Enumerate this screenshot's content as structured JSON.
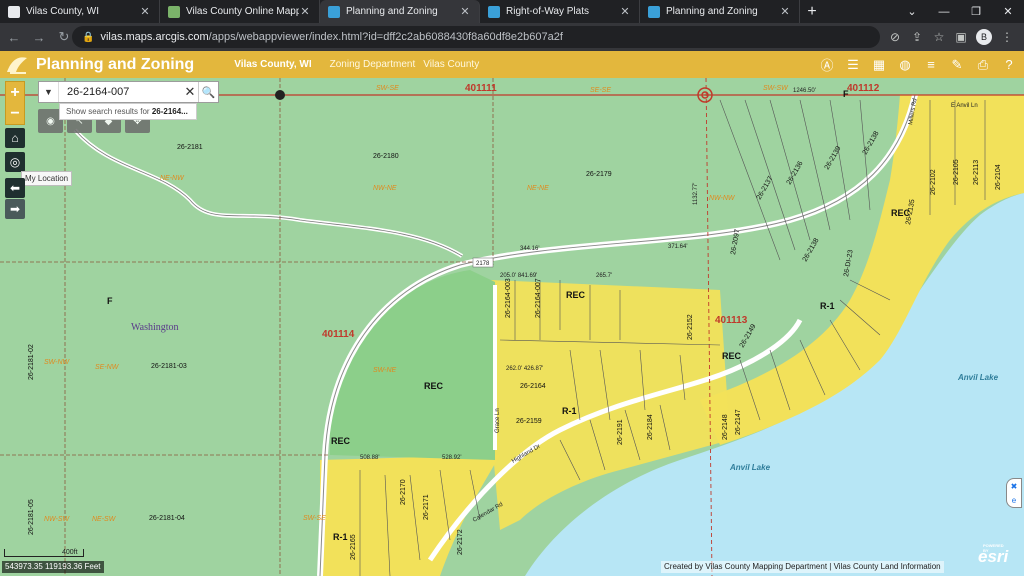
{
  "browser": {
    "tabs": [
      {
        "title": "Vilas County, WI",
        "active": false
      },
      {
        "title": "Vilas County Online Mapping",
        "active": false
      },
      {
        "title": "Planning and Zoning",
        "active": true
      },
      {
        "title": "Right-of-Way Plats",
        "active": false
      },
      {
        "title": "Planning and Zoning",
        "active": false
      }
    ],
    "new_tab": "+",
    "url_host": "vilas.maps.arcgis.com",
    "url_path": "/apps/webappviewer/index.html?id=dff2c2ab6088430f8a60df8e2b607a2f",
    "profile_initial": "B"
  },
  "app": {
    "title": "Planning and Zoning",
    "subtitle": "Vilas County, WI",
    "links": [
      "Zoning Department",
      "Vilas County"
    ],
    "tool_icons": [
      "north-arrow-icon",
      "layer-list-icon",
      "basemap-gallery-icon",
      "measure-icon",
      "legend-icon",
      "draw-icon",
      "print-icon",
      "help-icon"
    ]
  },
  "map": {
    "search_value": "26-2164-007",
    "search_suggestion_prefix": "Show search results for ",
    "search_suggestion_term": "26-2164...",
    "tooltip": "My Location",
    "scale_label": "400ft",
    "coordinates": "543973.35 119193.36 Feet",
    "attribution": "Created by Vilas County Mapping Department | Vilas County Land Information",
    "esri_powered": "POWERED BY",
    "esri_label": "esri",
    "colors": {
      "parcel": "#9fd3a0",
      "shoreland": "#f2e15a",
      "lake": "#b7e6f5",
      "section_line": "#c0392b"
    },
    "labels": {
      "sec_401111": "401111",
      "sec_401112": "401112",
      "sec_401113": "401113",
      "sec_401114": "401114",
      "township": "Washington",
      "f1": "F",
      "f2": "F",
      "rec1": "REC",
      "rec2": "REC",
      "rec3": "REC",
      "rec4": "REC",
      "rec5": "REC",
      "r1a": "R-1",
      "r1b": "R-1",
      "r1c": "R-1",
      "anvil_lake_1": "Anvil Lake",
      "anvil_lake_2": "Anvil Lake",
      "q_sw_se": "SW-SE",
      "q_se_se": "SE-SE",
      "q_sw_sw": "SW-SW",
      "q_ne_nw": "NE-NW",
      "q_nw_ne": "NW-NE",
      "q_ne_ne": "NE-NE",
      "q_nw_nw": "NW-NW",
      "q_sw_ne": "SW-NE",
      "q_se_nw": "SE-NW",
      "q_sw_nw": "SW-NW",
      "q_nw_sw": "NW-SW",
      "q_ne_sw": "NE-SW",
      "q_sw_sw2": "SW-SE",
      "p2181": "26-2181",
      "p2180": "26-2180",
      "p2179": "26-2179",
      "p2181_03": "26-2181-03",
      "p2181_02": "26-2181-02",
      "p2181_04": "26-2181-04",
      "p2181_05": "26-2181-05",
      "p2164": "26-2164",
      "p2164_003": "26-2164-003",
      "p2164_007": "26-2164-007",
      "p2159": "26-2159",
      "p2191": "26-2191",
      "p2184": "26-2184",
      "p2152": "26-2152",
      "p2149": "26-2149",
      "p2148": "26-2148",
      "p2147": "26-2147",
      "p2170": "26-2170",
      "p2171": "26-2171",
      "p2172": "26-2172",
      "p2165": "26-2165",
      "p2105": "26-2105",
      "p2102": "26-2102",
      "p2104": "26-2104",
      "p2113": "26-2113",
      "p2138": "26-2138",
      "p2139": "26-2139",
      "p2136": "26-2136",
      "p2137": "26-2137",
      "p2097": "26-2097",
      "p2135": "26-2135",
      "p2138b": "26-2138",
      "pdi23": "26-DI-23",
      "road_2178": "2178",
      "grace_ln": "Grace Ln",
      "highland_dr": "Highland Dr",
      "millers_rd": "Millers Rd",
      "anvil_ln": "E Anvil Ln",
      "calendar_rd": "Calendar Rd",
      "dim_344": "344.16'",
      "dim_3718": "371.64'",
      "dim_1246": "1246.50'",
      "dim_5088": "508.88'",
      "dim_5289": "528.92'",
      "dim_2656": "265.7'",
      "dim_2050": "205.0' 841.69'",
      "dim_2620": "262.0' 426.87'",
      "dim_1132": "1132.77'"
    }
  }
}
